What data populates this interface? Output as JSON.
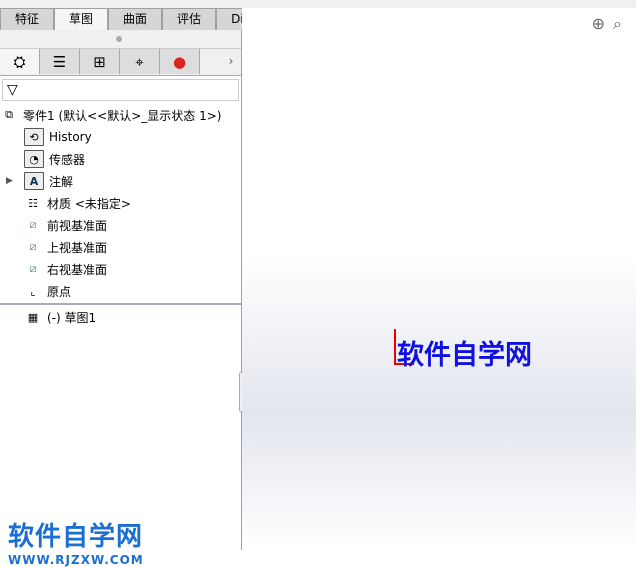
{
  "tabs": [
    "特征",
    "草图",
    "曲面",
    "评估",
    "DimXpert"
  ],
  "active_tab": 1,
  "tree": {
    "root": "零件1  (默认<<默认>_显示状态 1>)",
    "items": [
      "History",
      "传感器",
      "注解",
      "材质 <未指定>",
      "前视基准面",
      "上视基准面",
      "右视基准面",
      "原点"
    ],
    "sketch": "(-) 草图1"
  },
  "viewport": {
    "sketch_text": "软件自学网"
  },
  "watermark": {
    "title": "软件自学网",
    "url": "WWW.RJZXW.COM"
  }
}
